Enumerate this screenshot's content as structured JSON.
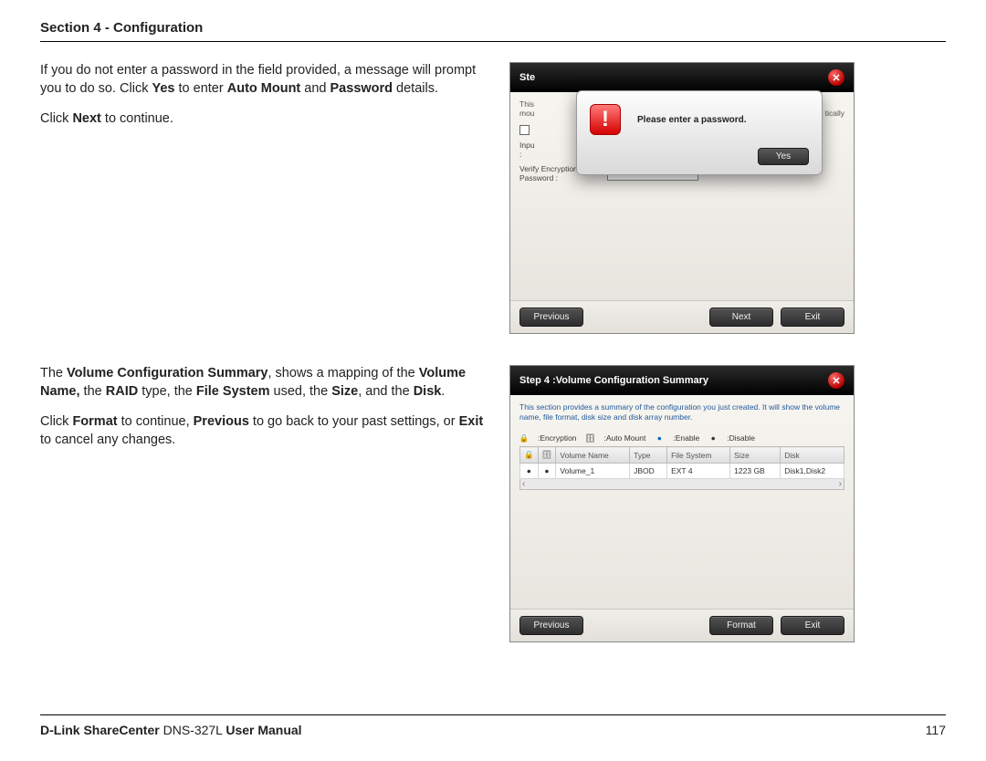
{
  "header": {
    "section_title": "Section 4 - Configuration"
  },
  "block1": {
    "p1_a": "If you do not enter a password in the field provided, a message will prompt you to do so. Click ",
    "p1_b1": "Yes",
    "p1_c": " to enter ",
    "p1_b2": "Auto Mount",
    "p1_d": " and ",
    "p1_b3": "Password",
    "p1_e": " details.",
    "p2_a": "Click ",
    "p2_b": "Next",
    "p2_c": " to continue."
  },
  "shot1": {
    "title_visible": "Ste",
    "desc_left": "This",
    "desc_left2": "mou",
    "desc_right_tail": "tically",
    "row_input_label": "Inpu",
    "row_input_label2": ":",
    "row_verify_label": "Verify Encryption\nPassword :",
    "modal_msg": "Please enter a password.",
    "modal_btn": "Yes",
    "btn_prev": "Previous",
    "btn_next": "Next",
    "btn_exit": "Exit"
  },
  "block2": {
    "p1_a": "The ",
    "p1_b1": "Volume Configuration Summary",
    "p1_c": ", shows a mapping of the ",
    "p1_b2": "Volume Name,",
    "p1_d": " the ",
    "p1_b3": "RAID",
    "p1_e": " type, the ",
    "p1_b4": "File System",
    "p1_f": " used, the ",
    "p1_b5": "Size",
    "p1_g": ", and the ",
    "p1_b6": "Disk",
    "p1_h": ".",
    "p2_a": "Click ",
    "p2_b1": "Format",
    "p2_c": " to continue, ",
    "p2_b2": "Previous",
    "p2_d": " to go back to your past settings, or ",
    "p2_b3": "Exit",
    "p2_e": " to cancel any changes."
  },
  "shot2": {
    "title": "Step 4 :Volume Configuration Summary",
    "desc": "This section provides a summary of the configuration you just created. It will show the volume name, file format, disk size and disk array number.",
    "legend": {
      "encryption": ":Encryption",
      "automount": ":Auto Mount",
      "enable": ":Enable",
      "disable": ":Disable"
    },
    "columns": {
      "c1": "",
      "c2": "",
      "c3": "Volume Name",
      "c4": "Type",
      "c5": "File System",
      "c6": "Size",
      "c7": "Disk"
    },
    "row": {
      "name": "Volume_1",
      "type": "JBOD",
      "fs": "EXT 4",
      "size": "1223 GB",
      "disk": "Disk1,Disk2"
    },
    "btn_prev": "Previous",
    "btn_format": "Format",
    "btn_exit": "Exit"
  },
  "footer": {
    "brand1": "D-Link ShareCenter",
    "brand2": " DNS-327L ",
    "brand3": "User Manual",
    "page": "117"
  }
}
